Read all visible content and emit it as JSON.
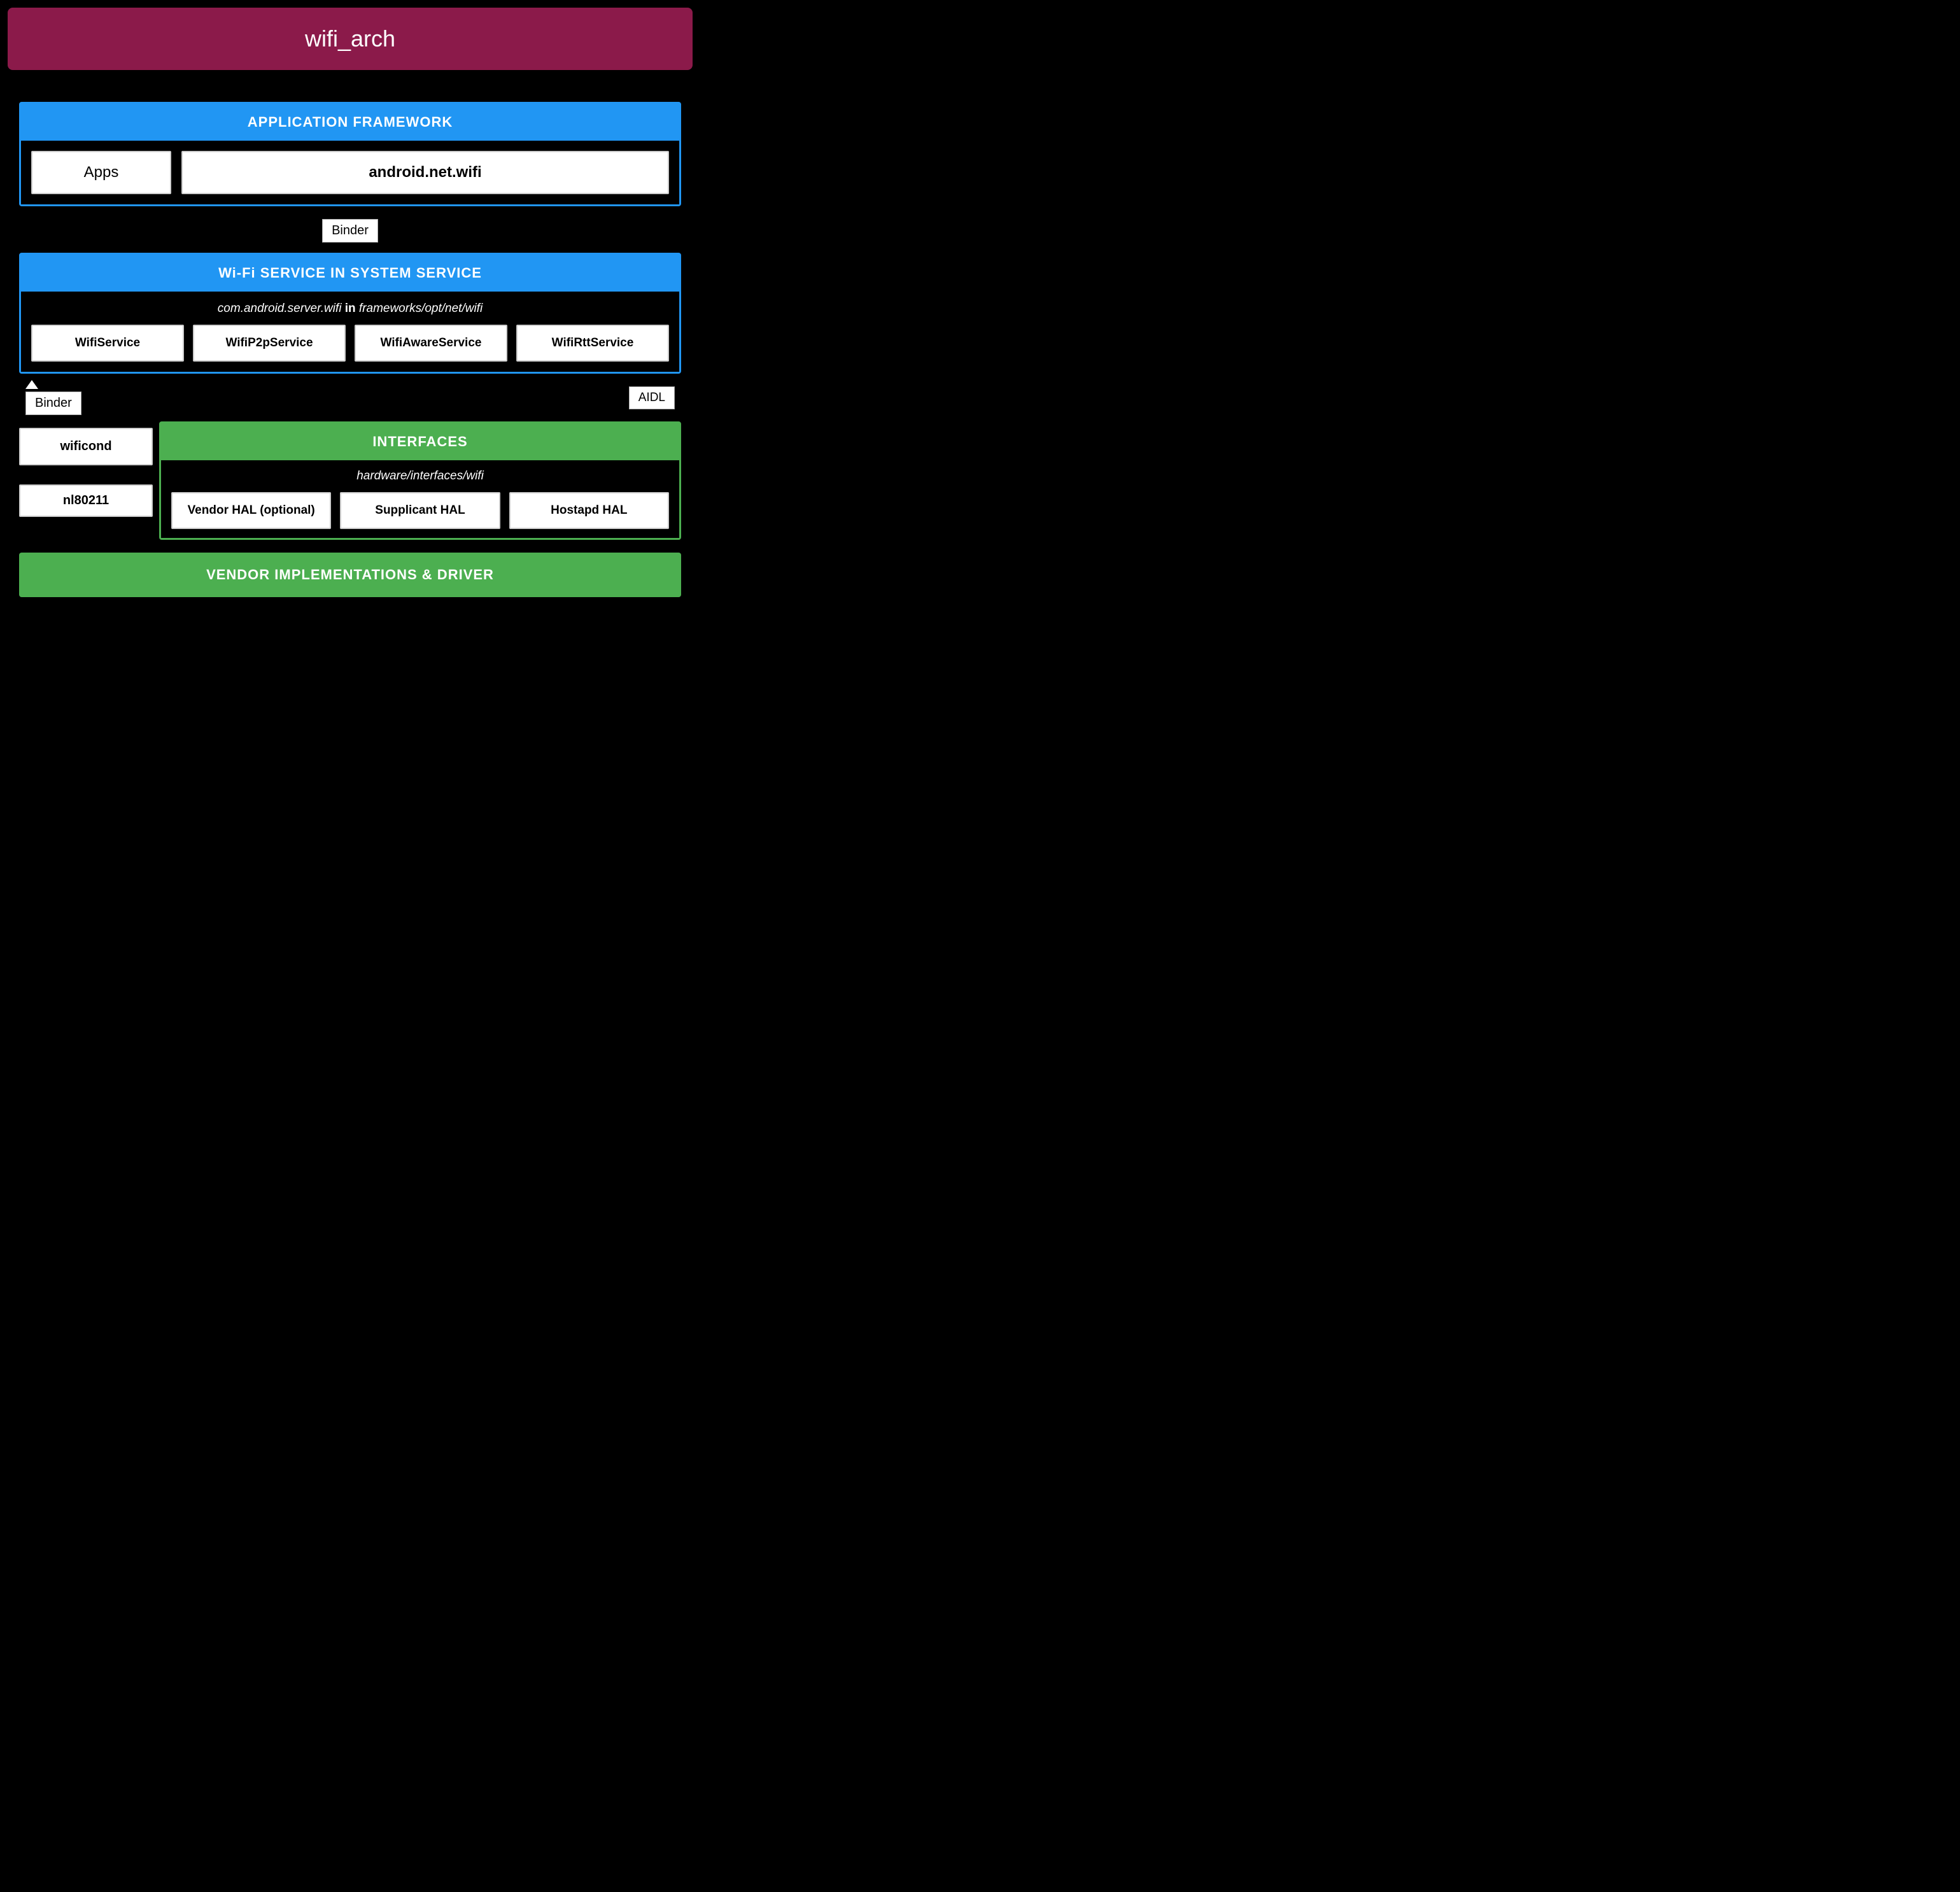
{
  "title": "wifi_arch",
  "colors": {
    "titleBg": "#8B1A4A",
    "blue": "#2196F3",
    "green": "#4CAF50",
    "black": "#000000",
    "white": "#FFFFFF"
  },
  "appFramework": {
    "header": "APPLICATION FRAMEWORK",
    "apps": "Apps",
    "androidNetWifi": "android.net.wifi"
  },
  "binder": "Binder",
  "aidl": "AIDL",
  "wifiService": {
    "header": "Wi-Fi SERVICE IN SYSTEM SERVICE",
    "subtitle_pre": "com.android.server.wifi",
    "subtitle_bold": " in ",
    "subtitle_post": "frameworks/opt/net/wifi",
    "services": [
      "WifiService",
      "WifiP2pService",
      "WifiAwareService",
      "WifiRttService"
    ]
  },
  "wificond": "wificond",
  "nl80211": "nl80211",
  "interfaces": {
    "header": "INTERFACES",
    "subtitle": "hardware/interfaces/wifi",
    "hals": [
      "Vendor HAL (optional)",
      "Supplicant HAL",
      "Hostapd HAL"
    ]
  },
  "vendor": "VENDOR IMPLEMENTATIONS & DRIVER"
}
